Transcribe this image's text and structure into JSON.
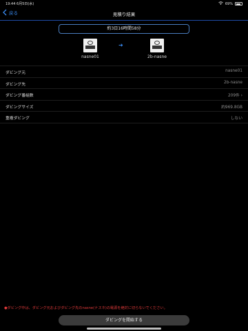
{
  "status_bar": {
    "time": "19:44",
    "date": "6月5日(水)",
    "battery_percent": "69%",
    "battery_level": 0.69
  },
  "nav": {
    "back_label": "戻る",
    "title": "見積り結果"
  },
  "estimate": {
    "text": "約3日16時間58分"
  },
  "source": {
    "name": "nasne01"
  },
  "destination": {
    "name": "2b-nasne"
  },
  "rows": [
    {
      "label": "ダビング元",
      "value": "nasne01"
    },
    {
      "label": "ダビング先",
      "value": "2b-nasne"
    },
    {
      "label": "ダビング番組数",
      "value": "209件 ›"
    },
    {
      "label": "ダビングサイズ",
      "value": "約969.8GB"
    },
    {
      "label": "重複ダビング",
      "value": "しない"
    }
  ],
  "warning": "●ダビング中は、ダビング元およびダビング先のnasne(ナスネ)の電源を絶対に切らないでください。",
  "start_button": "ダビングを開始する",
  "colors": {
    "accent": "#3a8bf2",
    "warning": "#e03a3a",
    "button_bg": "#3b3b3b"
  }
}
